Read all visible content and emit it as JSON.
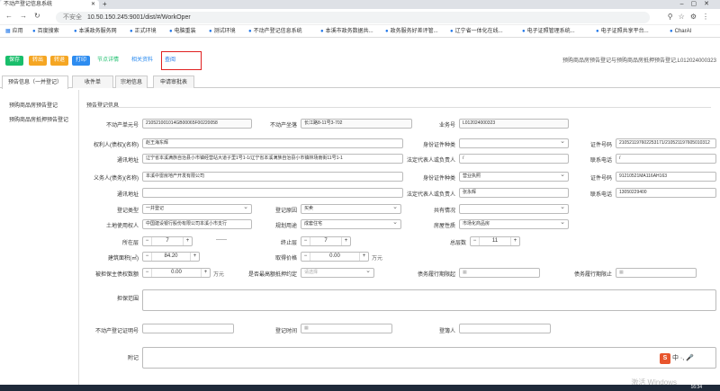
{
  "browser": {
    "tab_title": "不动产登记信息系统",
    "insecure": "不安全",
    "url": "10.50.150.245:9001/dist/#/WorkOper",
    "bookmarks": [
      "应用",
      "百度搜索",
      "本溪政务服务网",
      "正式环境",
      "电脑重装",
      "测试环境",
      "不动产登记信息系统",
      "本溪市政务数据共...",
      "政务服务好差评管...",
      "辽宁省一体化在线...",
      "电子证照管理系统...",
      "电子证照共享平台...",
      "CharAI"
    ]
  },
  "toolbar": {
    "save": "保存",
    "forward": "转出",
    "return": "转退",
    "print": "打印",
    "validation_detail": "节点详情",
    "related_materials": "相关资料",
    "query": "查阅"
  },
  "page_title": "预购商品房预告登记与预购商品房抵押预告登记,L012024000323",
  "tabs": [
    "预告信息（一并登记）",
    "收件单",
    "宗地信息",
    "申请审批表"
  ],
  "sidebar": [
    "预购商品房预告登记",
    "预购商品房抵押预告登记"
  ],
  "section_title": "预告登记信息",
  "form": {
    "unit_no_label": "不动产单元号",
    "unit_no": "210521001014GB00065F00220058",
    "location_label": "不动产坐落",
    "location": "长江路8-11号3-702",
    "business_no_label": "业务号",
    "business_no": "L012024000323",
    "obligee_label": "权利人(债权)(名称)",
    "obligee": "赵王海东辉",
    "id_type_label": "身份证件种类",
    "id_type": "",
    "id_no_label": "证件号码",
    "id_no": "210521197602253171/210521197605010312",
    "address_label": "通讯地址",
    "address": "辽宁省本溪满族自治县小市镇经营站大道子里1号1-1/辽宁省本溪满族自治县小市镇林场南街11号1-1",
    "legal_rep_label": "法定代表人或负责人",
    "legal_rep": "/",
    "phone_label": "联系电话",
    "phone": "/",
    "obligor_label": "义务人(债务)(名称)",
    "obligor": "本溪中雷房地产开发有限公司",
    "obligor_id_type_label": "身份证件种类",
    "obligor_id_type": "营业执照",
    "obligor_id_no_label": "证件号码",
    "obligor_id_no": "91210521MA116AH163",
    "obligor_address_label": "通讯地址",
    "obligor_address": "",
    "obligor_legal_rep_label": "法定代表人或负责人",
    "obligor_legal_rep": "张永辉",
    "obligor_phone_label": "联系电话",
    "obligor_phone": "13050229400",
    "reg_type_label": "登记类型",
    "reg_type": "一并登记",
    "reg_reason_label": "登记原因",
    "reg_reason": "买卖",
    "share_label": "共有情况",
    "share": "",
    "land_user_label": "土地使用权人",
    "land_user": "中国建设银行股份有限公司本溪小市支行",
    "planned_use_label": "规划用途",
    "planned_use": "成套住宅",
    "house_nature_label": "房屋性质",
    "house_nature": "市场化商品房",
    "floor_label": "所在层",
    "floor": "7",
    "end_floor_label": "终止层",
    "end_floor": "7",
    "total_floors_label": "总层数",
    "total_floors": "11",
    "area_label": "建筑面积(㎡)",
    "area": "84.20",
    "price_label": "取得价格",
    "price": "0.00",
    "price_unit": "万元",
    "guarantee_label": "被担保主债权数额",
    "guarantee": "0.00",
    "guarantee_unit": "万元",
    "max_mortgage_label": "是否最高额抵押约定",
    "max_mortgage_placeholder": "请选择",
    "debt_start_label": "债务履行期限起",
    "debt_end_label": "债务履行期限止",
    "scope_label": "担保范围",
    "cert_no_label": "不动产登记证明号",
    "reg_time_label": "登记时间",
    "registrar_label": "登簿人",
    "remarks_label": "附记"
  },
  "system": {
    "watermark": "激活 Windows",
    "clock": "16:34",
    "ime": "中"
  }
}
